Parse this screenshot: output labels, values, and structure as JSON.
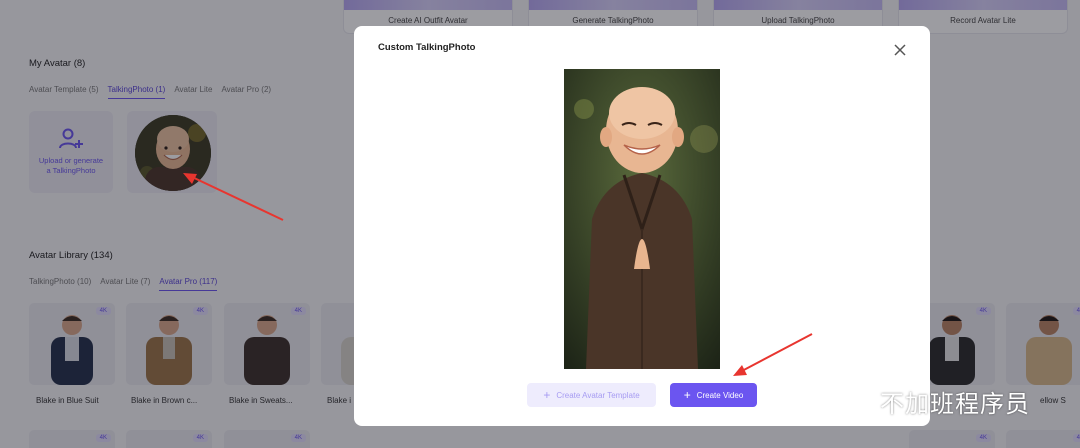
{
  "top_cards": [
    {
      "label": "Create AI Outfit Avatar"
    },
    {
      "label": "Generate TalkingPhoto"
    },
    {
      "label": "Upload TalkingPhoto"
    },
    {
      "label": "Record Avatar Lite"
    }
  ],
  "my_avatar": {
    "title": "My Avatar (8)",
    "tabs": [
      "Avatar Template (5)",
      "TalkingPhoto (1)",
      "Avatar Lite",
      "Avatar Pro (2)"
    ],
    "active_tab": "TalkingPhoto (1)",
    "upload_line1": "Upload or generate",
    "upload_line2": "a TalkingPhoto"
  },
  "library": {
    "title": "Avatar Library (134)",
    "tabs": [
      "TalkingPhoto (10)",
      "Avatar Lite (7)",
      "Avatar Pro (117)"
    ],
    "active_tab": "Avatar Pro (117)",
    "badge": "4K",
    "items": [
      {
        "name": "Blake in Blue Suit"
      },
      {
        "name": "Blake in Brown c..."
      },
      {
        "name": "Blake in Sweats..."
      },
      {
        "name": "Blake i"
      },
      {
        "name": "ellow S"
      }
    ]
  },
  "modal": {
    "title": "Custom TalkingPhoto",
    "create_template_label": "Create Avatar Template",
    "create_video_label": "Create Video"
  },
  "watermark": {
    "text": "不加班程序员"
  },
  "colors": {
    "accent": "#6b55f0",
    "accent_light": "#eeecfd",
    "arrow": "#e8352f"
  }
}
